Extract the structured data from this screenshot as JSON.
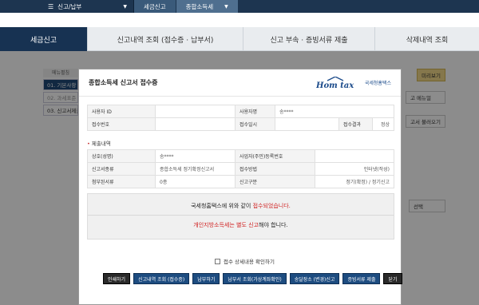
{
  "topnav": {
    "menu_label": "신고/납부",
    "crumbs": [
      "세금신고",
      "종합소득세"
    ]
  },
  "tabs": [
    "세금신고",
    "신고내역 조회 (접수증 · 납부서)",
    "신고 부속 · 증빙서류 제출",
    "삭제내역 조회"
  ],
  "sidebar": {
    "header": "메뉴펼침",
    "items": [
      "01. 기본사항",
      "02. 과세표준",
      "03. 신고서제출"
    ]
  },
  "right_bg": [
    "미리보기",
    "고 메뉴얼",
    "고서 불러오기",
    "선택"
  ],
  "modal": {
    "title": "종합소득세 신고서 접수증",
    "logo_text": "Hom tax",
    "logo_sub": "국세청홈택스",
    "info": {
      "user_id_label": "사용자 ID",
      "user_id_value": "",
      "user_name_label": "사용자명",
      "user_name_value": "송****",
      "receipt_no_label": "접수번호",
      "receipt_no_value": "",
      "receipt_date_label": "접수일시",
      "receipt_date_value": "",
      "receipt_result_label": "접수결과",
      "receipt_result_value": "정상"
    },
    "section_title": "제출내역",
    "details": {
      "name_label": "상호(성명)",
      "name_value": "송****",
      "bizno_label": "사업자(주민)등록번호",
      "bizno_value": "",
      "type_label": "신고서종류",
      "type_value": "종합소득세 정기확정신고서",
      "method_label": "접수방법",
      "method_value": "인터넷(작성)",
      "attach_label": "첨부된서류",
      "attach_value": "0종",
      "category_label": "신고구분",
      "category_value": "정기(확정) / 정기신고"
    },
    "notice": {
      "line1_pre": "국세청홈택스에 위와 같이 ",
      "line1_red": "접수되었습니다.",
      "line2_red": "개인지방소득세는 별도 신고",
      "line2_post": "해야 합니다."
    },
    "checkbox_label": "접수 상세내용 확인하기",
    "buttons": [
      "인쇄하기",
      "신고내역 조회 (접수증)",
      "납부하기",
      "납부서 조회(가상계좌확인)",
      "송달장소 (변경)신고",
      "증빙서류 제출",
      "닫기"
    ]
  }
}
